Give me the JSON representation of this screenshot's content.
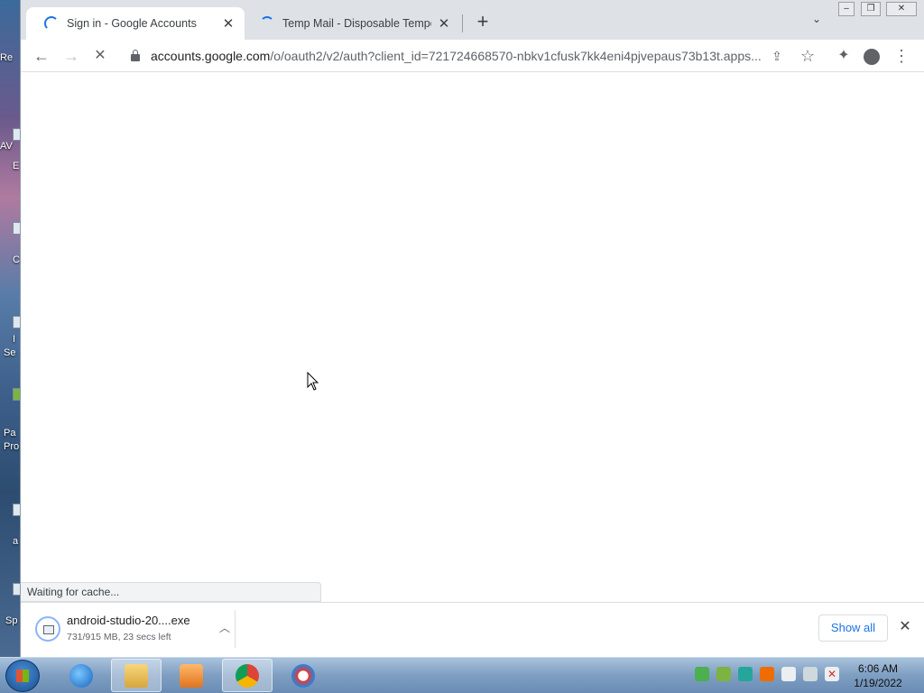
{
  "browser": {
    "tabs": [
      {
        "title": "Sign in - Google Accounts",
        "active": true,
        "loading": true
      },
      {
        "title": "Temp Mail - Disposable Tempora",
        "active": false,
        "loading": true
      }
    ],
    "icons": {
      "new_tab": "plus-icon",
      "tab_search": "chevron-down-icon",
      "back": "arrow-left-icon",
      "forward": "arrow-right-icon",
      "stop": "stop-x-icon",
      "lock": "lock-icon",
      "share": "share-icon",
      "bookmark": "star-icon",
      "extensions": "puzzle-icon",
      "profile": "person-icon",
      "menu": "kebab-icon"
    },
    "url": {
      "host": "accounts.google.com",
      "path": "/o/oauth2/v2/auth?client_id=721724668570-nbkv1cfusk7kk4eni4pjvepaus73b13t.apps..."
    },
    "status_text": "Waiting for cache..."
  },
  "downloads": {
    "item": {
      "name": "android-studio-20....exe",
      "status": "731/915 MB, 23 secs left"
    },
    "show_all_label": "Show all"
  },
  "taskbar": {
    "time": "6:06 AM",
    "date": "1/19/2022"
  },
  "desktop": {
    "icon_labels": [
      "Re",
      "AV",
      "E",
      "C",
      "I",
      "Se",
      "Pa",
      "Pro",
      "a",
      "Sp"
    ]
  },
  "colors": {
    "accent": "#1a73e8",
    "tab_strip": "#dee1e6",
    "taskbar": "#7e9ec2"
  }
}
